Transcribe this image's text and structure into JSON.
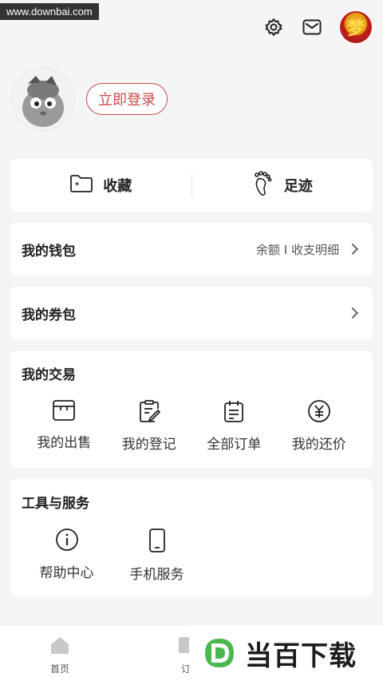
{
  "watermark": "www.downbai.com",
  "header": {
    "settings_icon": "gear-icon",
    "mail_icon": "mail-icon",
    "avatar_char": "梦"
  },
  "profile": {
    "login_label": "立即登录"
  },
  "shortcuts": [
    {
      "label": "收藏",
      "icon": "folder-star-icon"
    },
    {
      "label": "足迹",
      "icon": "footprint-icon"
    }
  ],
  "wallet": {
    "title": "我的钱包",
    "detail": "余额 I 收支明细"
  },
  "coupon": {
    "title": "我的券包"
  },
  "trade": {
    "title": "我的交易",
    "items": [
      {
        "label": "我的出售",
        "icon": "shop-icon"
      },
      {
        "label": "我的登记",
        "icon": "register-icon"
      },
      {
        "label": "全部订单",
        "icon": "order-icon"
      },
      {
        "label": "我的还价",
        "icon": "yen-icon"
      }
    ]
  },
  "tools": {
    "title": "工具与服务",
    "items": [
      {
        "label": "帮助中心",
        "icon": "info-icon"
      },
      {
        "label": "手机服务",
        "icon": "phone-icon"
      }
    ]
  },
  "tabbar": {
    "home_label": "首页",
    "order_label_partial": "订"
  },
  "brand": {
    "text": "当百下载",
    "logo_letter": "D"
  },
  "colors": {
    "accent": "#c94a4a",
    "background": "#f5f5f5"
  }
}
